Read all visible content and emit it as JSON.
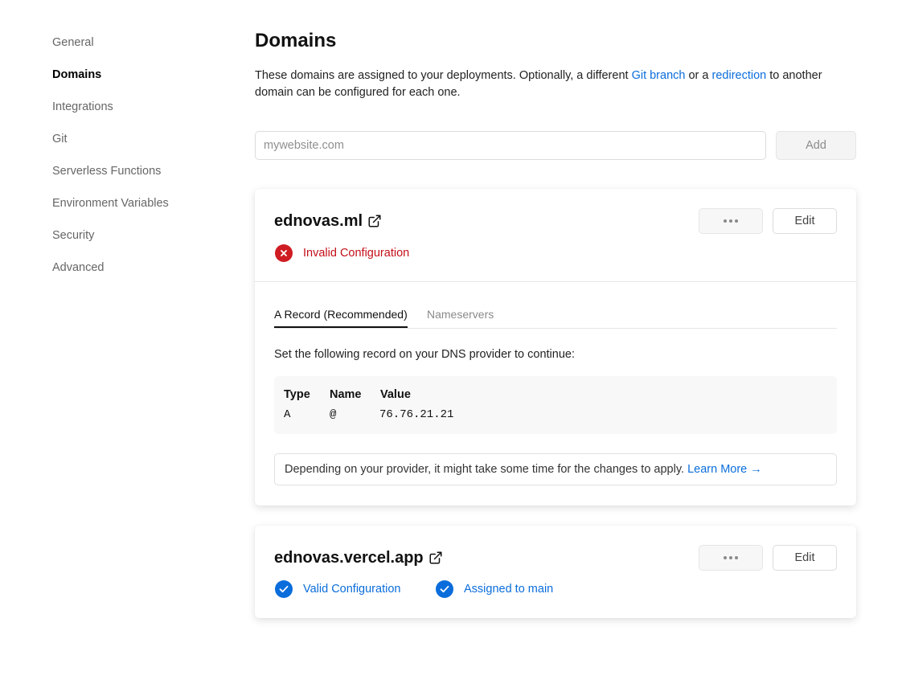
{
  "sidebar": {
    "items": [
      {
        "label": "General"
      },
      {
        "label": "Domains",
        "active": true
      },
      {
        "label": "Integrations"
      },
      {
        "label": "Git"
      },
      {
        "label": "Serverless Functions"
      },
      {
        "label": "Environment Variables"
      },
      {
        "label": "Security"
      },
      {
        "label": "Advanced"
      }
    ]
  },
  "page": {
    "title": "Domains",
    "description": {
      "part1": "These domains are assigned to your deployments. Optionally, a different ",
      "link1": "Git branch",
      "part2": " or a ",
      "link2": "redirection",
      "part3": " to another domain can be configured for each one."
    }
  },
  "add_domain": {
    "placeholder": "mywebsite.com",
    "value": "",
    "button_label": "Add"
  },
  "domains": [
    {
      "name": "ednovas.ml",
      "edit_label": "Edit",
      "status": {
        "label": "Invalid Configuration",
        "color": "#cf1c23",
        "icon": "x-icon"
      },
      "tabs": [
        {
          "label": "A Record (Recommended)",
          "active": true
        },
        {
          "label": "Nameservers",
          "active": false
        }
      ],
      "instruction": "Set the following record on your DNS provider to continue:",
      "record": {
        "headers": [
          "Type",
          "Name",
          "Value"
        ],
        "row": [
          "A",
          "@",
          "76.76.21.21"
        ]
      },
      "note": {
        "text": "Depending on your provider, it might take some time for the changes to apply. ",
        "link": "Learn More →"
      }
    },
    {
      "name": "ednovas.vercel.app",
      "edit_label": "Edit",
      "statuses": [
        {
          "label": "Valid Configuration",
          "color": "#0a6ddb",
          "icon": "check-icon"
        },
        {
          "label": "Assigned to main",
          "color": "#0a6ddb",
          "icon": "check-icon"
        }
      ]
    }
  ],
  "colors": {
    "link": "#0a6ddb",
    "error": "#cf1c23",
    "success": "#0a6ddb"
  }
}
